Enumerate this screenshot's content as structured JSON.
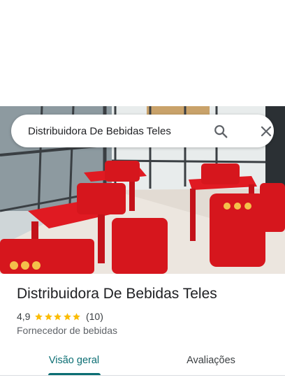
{
  "search": {
    "query": "Distribuidora De Bebidas Teles"
  },
  "icons": {
    "search": "search-icon",
    "close": "close-icon",
    "star": "star-icon"
  },
  "place": {
    "name": "Distribuidora De Bebidas Teles",
    "rating": "4,9",
    "stars": 5,
    "review_count": "(10)",
    "category": "Fornecedor de bebidas"
  },
  "tabs": [
    {
      "label": "Visão geral",
      "active": true
    },
    {
      "label": "Avaliações",
      "active": false
    }
  ],
  "colors": {
    "accent": "#0b6e73",
    "star": "#fbbc04",
    "chair_red": "#d6161d"
  }
}
